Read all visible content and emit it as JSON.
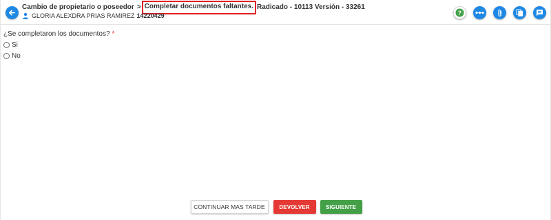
{
  "header": {
    "breadcrumb_parent": "Cambio de propietario o poseedor",
    "breadcrumb_separator": ">",
    "current_task": "Completar documentos faltantes.",
    "radicado": "Radicado - 10113 Versión - 33261",
    "user_name": "GLORIA ALEXDRA PRIAS RAMIREZ",
    "user_id": "14220429",
    "icons": [
      "back-arrow-icon",
      "help-icon",
      "more-icon",
      "attachment-icon",
      "copy-icon",
      "comments-icon"
    ],
    "colors": {
      "accent": "#1e88e5",
      "highlight_border": "#e21f26"
    }
  },
  "form": {
    "question": "¿Se completaron los documentos?",
    "required_mark": "*",
    "options": [
      "Si",
      "No"
    ]
  },
  "footer": {
    "later_label": "CONTINUAR MAS TARDE",
    "return_label": "DEVOLVER",
    "next_label": "SIGUIENTE",
    "colors": {
      "return": "#e53935",
      "next": "#43a047"
    }
  }
}
